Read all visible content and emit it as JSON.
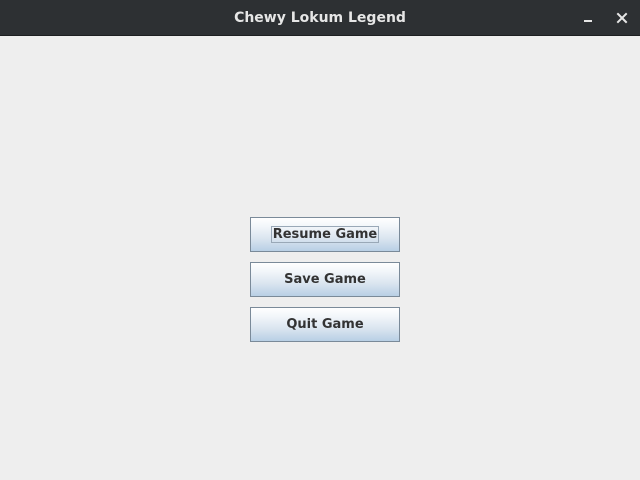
{
  "window": {
    "title": "Chewy Lokum Legend",
    "controls": {
      "minimize_icon": "minimize-icon",
      "close_icon": "close-icon"
    }
  },
  "menu": {
    "buttons": [
      {
        "label": "Resume Game",
        "focused": true
      },
      {
        "label": "Save Game",
        "focused": false
      },
      {
        "label": "Quit Game",
        "focused": false
      }
    ]
  },
  "colors": {
    "titlebar_bg": "#2d3033",
    "content_bg": "#eeeeee",
    "button_border": "#7a8a99",
    "button_text": "#333333"
  }
}
